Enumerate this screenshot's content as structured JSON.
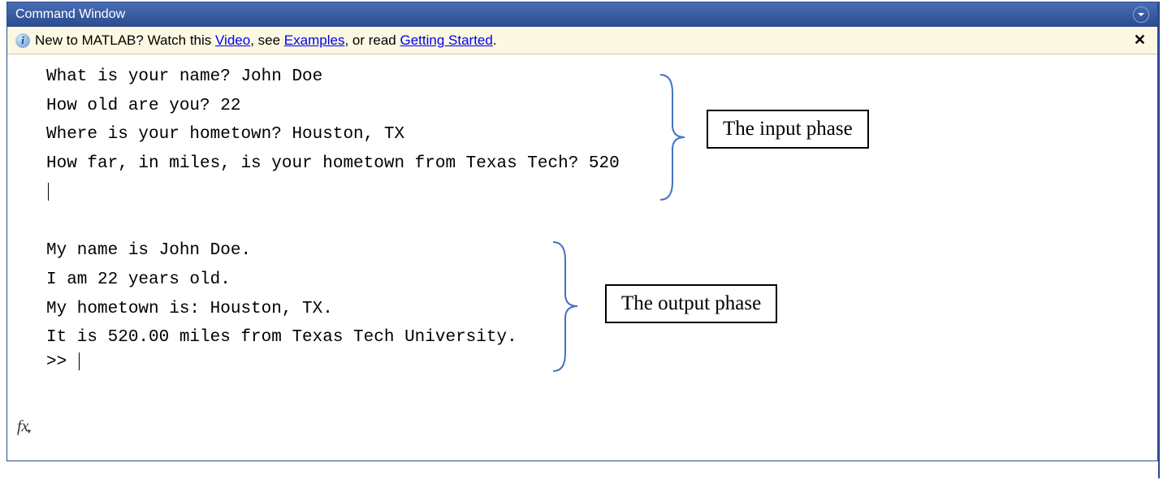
{
  "titlebar": {
    "title": "Command Window"
  },
  "info_bar": {
    "prefix": "New to MATLAB? Watch this ",
    "link1": "Video",
    "mid1": ", see ",
    "link2": "Examples",
    "mid2": ", or read ",
    "link3": "Getting Started",
    "suffix": "."
  },
  "console": {
    "line1": "What is your name? John Doe",
    "line2": "How old are you? 22",
    "line3": "Where is your hometown? Houston, TX",
    "line4": "How far, in miles, is your hometown from Texas Tech? 520",
    "line5": "My name is John Doe.",
    "line6": "I am 22 years old.",
    "line7": "My hometown is: Houston, TX.",
    "line8": "It is 520.00 miles from Texas Tech University.",
    "prompt": ">> "
  },
  "annotations": {
    "input_label": "The input phase",
    "output_label": "The output phase"
  }
}
